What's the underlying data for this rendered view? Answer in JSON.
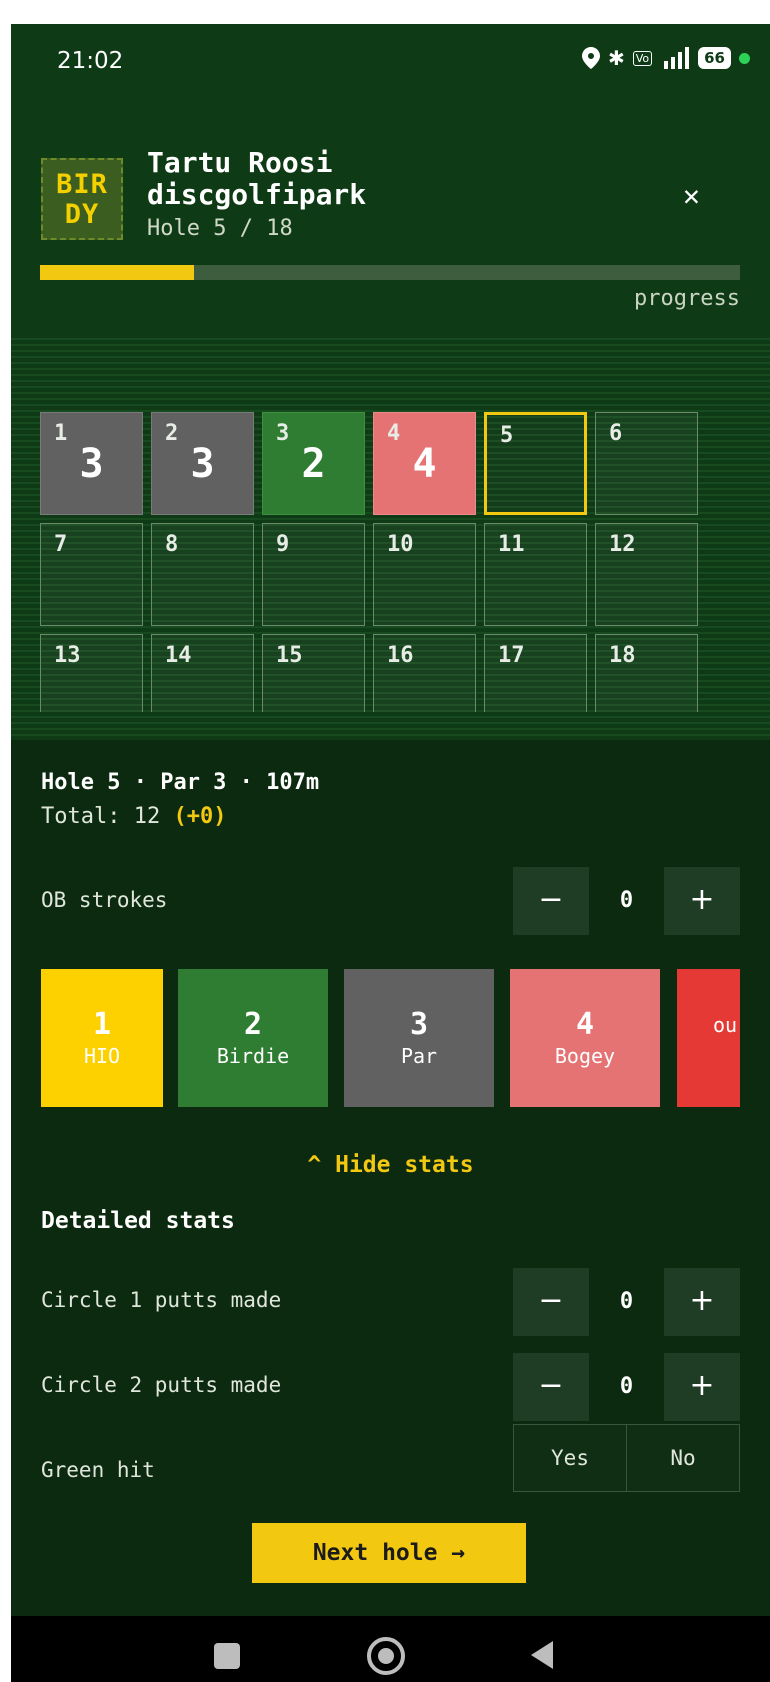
{
  "status_bar": {
    "time": "21:02",
    "battery": "66",
    "icons": [
      "location-icon",
      "bluetooth-icon",
      "volte-icon",
      "signal-4g-icon",
      "battery-icon",
      "active-dot-icon"
    ]
  },
  "header": {
    "logo_line1": "BIR",
    "logo_line2": "DY",
    "course_line1": "Tartu Roosi",
    "course_line2": "discgolfipark",
    "hole_label": "Hole 5 / 18",
    "close_icon": "✕",
    "progress_fraction": 0.22,
    "progress_label": "progress"
  },
  "holes": [
    {
      "number": "1",
      "score": "3",
      "state": "par"
    },
    {
      "number": "2",
      "score": "3",
      "state": "par"
    },
    {
      "number": "3",
      "score": "2",
      "state": "birdie"
    },
    {
      "number": "4",
      "score": "4",
      "state": "bogey"
    },
    {
      "number": "5",
      "score": "",
      "state": "current"
    },
    {
      "number": "6",
      "score": "",
      "state": "empty"
    },
    {
      "number": "7",
      "score": "",
      "state": "empty"
    },
    {
      "number": "8",
      "score": "",
      "state": "empty"
    },
    {
      "number": "9",
      "score": "",
      "state": "empty"
    },
    {
      "number": "10",
      "score": "",
      "state": "empty"
    },
    {
      "number": "11",
      "score": "",
      "state": "empty"
    },
    {
      "number": "12",
      "score": "",
      "state": "empty"
    },
    {
      "number": "13",
      "score": "",
      "state": "empty"
    },
    {
      "number": "14",
      "score": "",
      "state": "empty"
    },
    {
      "number": "15",
      "score": "",
      "state": "empty"
    },
    {
      "number": "16",
      "score": "",
      "state": "empty"
    },
    {
      "number": "17",
      "score": "",
      "state": "empty"
    },
    {
      "number": "18",
      "score": "",
      "state": "empty"
    }
  ],
  "hole_info": {
    "line1": "Hole 5 · Par 3 · 107m",
    "total_label": "Total: 12",
    "total_rel": "(+0)"
  },
  "ob": {
    "label": "OB strokes",
    "value": "0",
    "minus": "−",
    "plus": "+"
  },
  "score_buttons": [
    {
      "value": "1",
      "label": "HIO",
      "color": "#fdd000"
    },
    {
      "value": "2",
      "label": "Birdie",
      "color": "#2e7d32"
    },
    {
      "value": "3",
      "label": "Par",
      "color": "#616161"
    },
    {
      "value": "4",
      "label": "Bogey",
      "color": "#e57373"
    },
    {
      "value": "",
      "label": "ou",
      "color": "#e53935"
    }
  ],
  "toggle_stats": "^ Hide stats",
  "detailed_title": "Detailed stats",
  "circle1": {
    "label": "Circle 1 putts made",
    "value": "0",
    "minus": "−",
    "plus": "+"
  },
  "circle2": {
    "label": "Circle 2 putts made",
    "value": "0",
    "minus": "−",
    "plus": "+"
  },
  "green_hit": {
    "label": "Green hit",
    "yes": "Yes",
    "no": "No"
  },
  "next_hole": "Next hole →",
  "colors": {
    "accent": "#f2c811",
    "background": "#0c2a0f",
    "header": "#0f3a16"
  }
}
